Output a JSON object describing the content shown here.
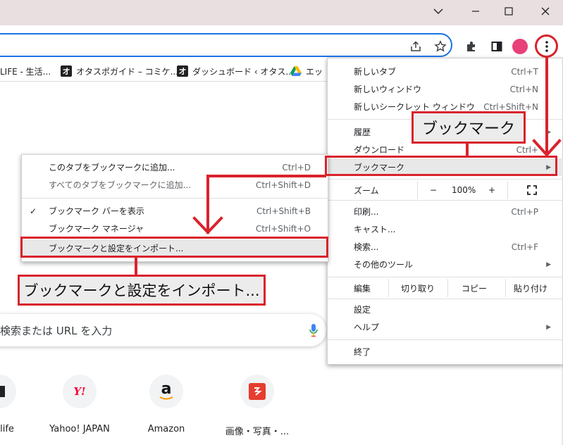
{
  "colors": {
    "accent": "#d9232d",
    "focus": "#1a73e8",
    "titlebar": "#e9dfe0",
    "avatar": "#e8417a"
  },
  "window": {
    "minimize_icon": "minimize-icon",
    "maximize_icon": "maximize-icon",
    "close_icon": "close-icon"
  },
  "bookmarks": [
    {
      "label": "LIFE - 生活..."
    },
    {
      "label": "オタスポガイド – コミケ...",
      "favicon": "オ"
    },
    {
      "label": "ダッシュボード ‹ オタス...",
      "favicon": "オ"
    },
    {
      "label": "エッ"
    }
  ],
  "menu": {
    "new_tab": {
      "label": "新しいタブ",
      "shortcut": "Ctrl+T"
    },
    "new_window": {
      "label": "新しいウィンドウ",
      "shortcut": "Ctrl+N"
    },
    "incognito": {
      "label": "新しいシークレット ウィンドウ",
      "shortcut": "Ctrl+Shift+N"
    },
    "history": {
      "label": "履歴"
    },
    "downloads": {
      "label": "ダウンロード",
      "shortcut": "Ctrl+"
    },
    "bookmarks": {
      "label": "ブックマーク"
    },
    "zoom": {
      "label": "ズーム",
      "minus": "−",
      "level": "100%",
      "plus": "+"
    },
    "print": {
      "label": "印刷...",
      "shortcut": "Ctrl+P"
    },
    "cast": {
      "label": "キャスト..."
    },
    "find": {
      "label": "検索...",
      "shortcut": "Ctrl+F"
    },
    "more_tools": {
      "label": "その他のツール"
    },
    "edit": {
      "label": "編集",
      "cut": "切り取り",
      "copy": "コピー",
      "paste": "貼り付け"
    },
    "settings": {
      "label": "設定"
    },
    "help": {
      "label": "ヘルプ"
    },
    "exit": {
      "label": "終了"
    }
  },
  "submenu": {
    "bookmark_tab": {
      "label": "このタブをブックマークに追加...",
      "shortcut": "Ctrl+D"
    },
    "bookmark_all": {
      "label": "すべてのタブをブックマークに追加...",
      "shortcut": "Ctrl+Shift+D"
    },
    "show_bar": {
      "label": "ブックマーク バーを表示",
      "shortcut": "Ctrl+Shift+B",
      "check": "✓"
    },
    "manager": {
      "label": "ブックマーク マネージャ",
      "shortcut": "Ctrl+Shift+O"
    },
    "import": {
      "label": "ブックマークと設定をインポート..."
    }
  },
  "callouts": {
    "bookmark": "ブックマーク",
    "import": "ブックマークと設定をインポート..."
  },
  "search": {
    "placeholder": "検索または URL を入力"
  },
  "shortcuts": [
    {
      "label": "life"
    },
    {
      "label": "Yahoo! JAPAN",
      "icon_text": "Y!"
    },
    {
      "label": "Amazon",
      "icon_text": "a"
    },
    {
      "label": "画像・写真・..."
    }
  ]
}
